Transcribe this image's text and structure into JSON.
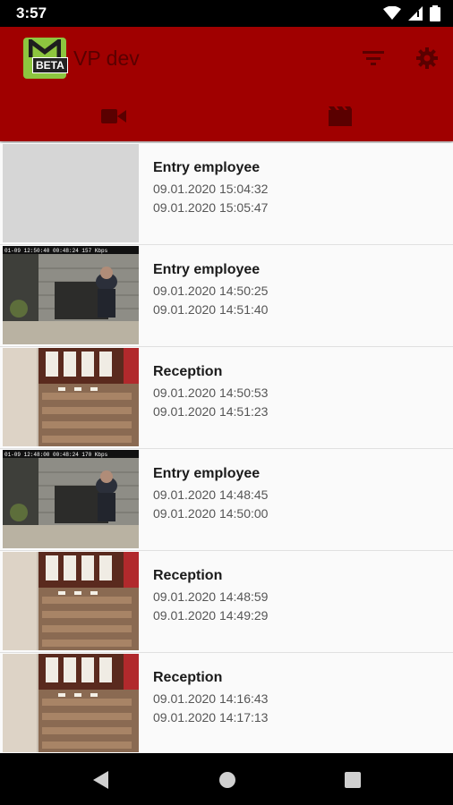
{
  "status_bar": {
    "time": "3:57"
  },
  "app_bar": {
    "title": "VP dev",
    "logo_badge": "BETA",
    "actions": [
      "filter-icon",
      "settings-icon"
    ]
  },
  "tabs": [
    {
      "icon": "videocam-icon",
      "selected": false
    },
    {
      "icon": "movie-icon",
      "selected": true
    }
  ],
  "recordings": [
    {
      "title": "Entry employee",
      "start": "09.01.2020 15:04:32",
      "end": "09.01.2020 15:05:47",
      "thumb": "placeholder"
    },
    {
      "title": "Entry employee",
      "start": "09.01.2020 14:50:25",
      "end": "09.01.2020 14:51:40",
      "thumb": "entry",
      "overlay": "01-09 12:50:40 00:48:24 157 Kbps"
    },
    {
      "title": "Reception",
      "start": "09.01.2020 14:50:53",
      "end": "09.01.2020 14:51:23",
      "thumb": "reception"
    },
    {
      "title": "Entry employee",
      "start": "09.01.2020 14:48:45",
      "end": "09.01.2020 14:50:00",
      "thumb": "entry",
      "overlay": "01-09 12:48:00 00:48:24 170 Kbps"
    },
    {
      "title": "Reception",
      "start": "09.01.2020 14:48:59",
      "end": "09.01.2020 14:49:29",
      "thumb": "reception"
    },
    {
      "title": "Reception",
      "start": "09.01.2020 14:16:43",
      "end": "09.01.2020 14:17:13",
      "thumb": "reception"
    }
  ],
  "nav_bar": [
    "back-icon",
    "home-icon",
    "recents-icon"
  ]
}
